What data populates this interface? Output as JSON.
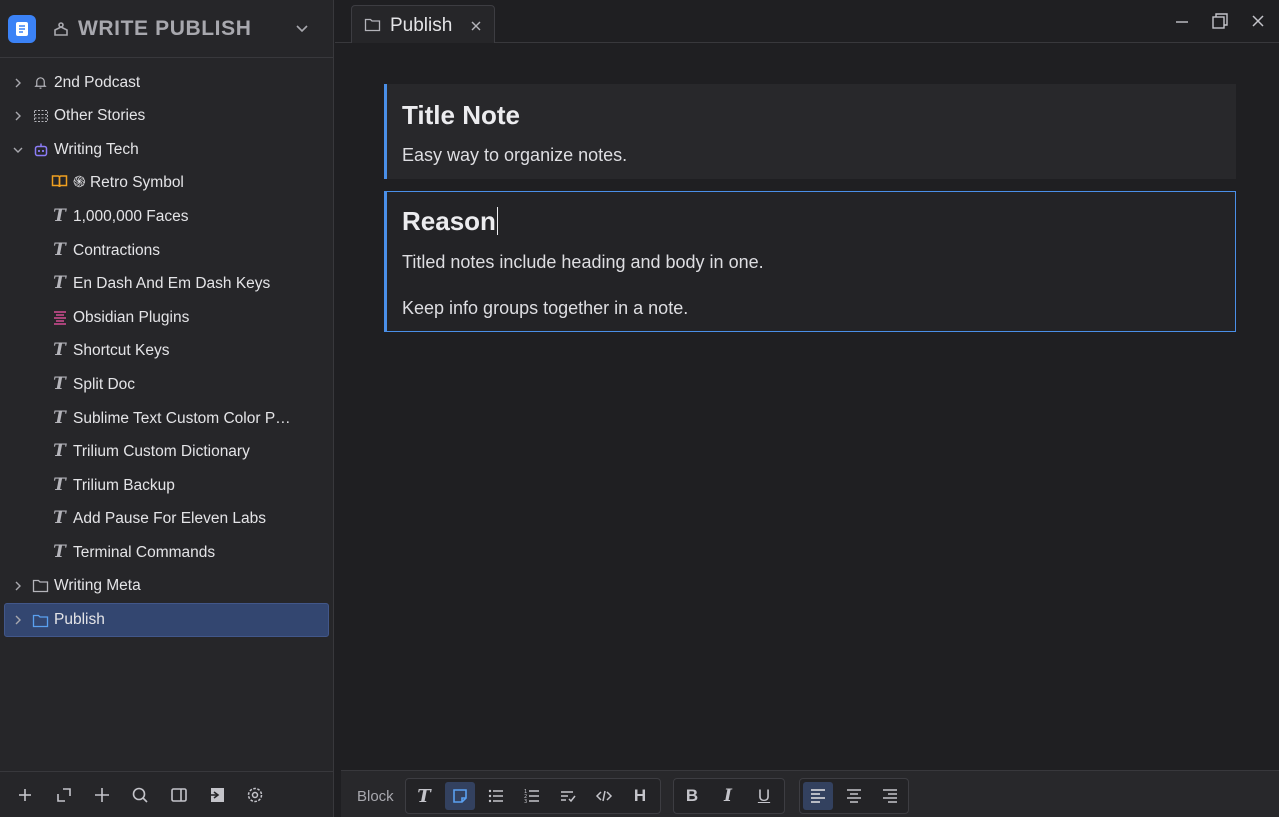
{
  "workspace": {
    "title": "WRITE PUBLISH"
  },
  "tree": [
    {
      "label": "2nd Podcast",
      "icon": "bell-icon"
    },
    {
      "label": "Other Stories",
      "icon": "grid-icon"
    },
    {
      "label": "Writing Tech",
      "icon": "robot-icon"
    },
    {
      "label": "Retro Symbol",
      "icon": "book-icon"
    },
    {
      "label": "1,000,000 Faces",
      "icon": "text-note-icon"
    },
    {
      "label": "Contractions",
      "icon": "text-note-icon"
    },
    {
      "label": "En Dash And Em Dash Keys",
      "icon": "text-note-icon"
    },
    {
      "label": "Obsidian Plugins",
      "icon": "list-icon"
    },
    {
      "label": "Shortcut Keys",
      "icon": "text-note-icon"
    },
    {
      "label": "Split Doc",
      "icon": "text-note-icon"
    },
    {
      "label": "Sublime Text Custom Color P…",
      "icon": "text-note-icon"
    },
    {
      "label": "Trilium Custom Dictionary",
      "icon": "text-note-icon"
    },
    {
      "label": "Trilium Backup",
      "icon": "text-note-icon"
    },
    {
      "label": "Add Pause For Eleven Labs",
      "icon": "text-note-icon"
    },
    {
      "label": "Terminal Commands",
      "icon": "text-note-icon"
    },
    {
      "label": "Writing Meta",
      "icon": "folder-icon"
    },
    {
      "label": "Publish",
      "icon": "folder-icon"
    }
  ],
  "tab": {
    "label": "Publish"
  },
  "icons": {
    "text_note_glyph": "T",
    "retro_symbol_glyph": "֍"
  },
  "notes": [
    {
      "title": "Title Note",
      "body": [
        "Easy way to organize notes."
      ]
    },
    {
      "title": "Reason",
      "body": [
        "Titled notes include heading and body in one.",
        "Keep info groups together in a note."
      ]
    }
  ],
  "toolbar": {
    "block_label": "Block",
    "heading_glyph": "H",
    "bold_glyph": "B",
    "italic_glyph": "I",
    "underline_glyph": "U",
    "text_glyph": "T"
  },
  "colors": {
    "accent": "#4a8fe8",
    "selected_row": "#334670",
    "background": "#1f1f22",
    "sidebar": "#262629"
  }
}
